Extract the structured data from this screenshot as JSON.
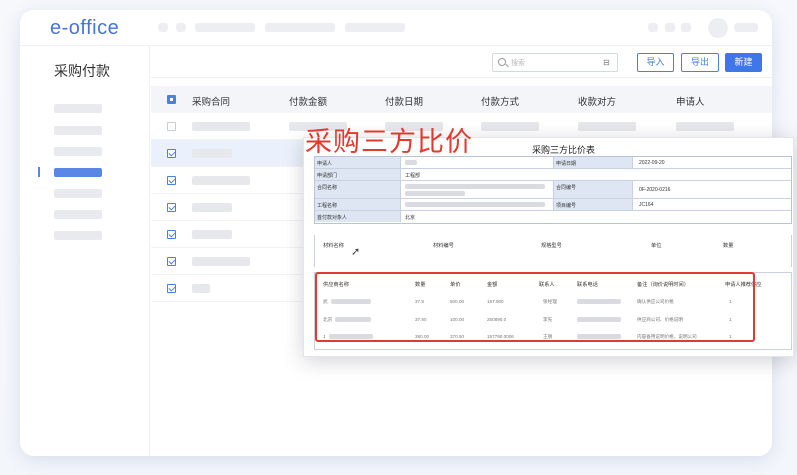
{
  "app": {
    "logo": "e-office"
  },
  "sidebar": {
    "title": "采购付款"
  },
  "toolbar": {
    "search_placeholder": "搜索",
    "filter_glyph": "⊟",
    "import_label": "导入",
    "export_label": "导出",
    "new_label": "新建"
  },
  "table": {
    "headers": [
      "采购合同",
      "付款金额",
      "付款日期",
      "付款方式",
      "收款对方",
      "申请人"
    ],
    "selected_rows": [
      1,
      2,
      3,
      4,
      5,
      6
    ]
  },
  "overlay": {
    "headline": "采购三方比价",
    "form_title": "采购三方比价表",
    "form": {
      "applicant_label": "申请人",
      "apply_date_label": "申请日期",
      "apply_date_value": "2022-09-20",
      "dept_label": "申请部门",
      "dept_value": "工程部",
      "contract_name_label": "合同名称",
      "contract_no_label": "合同编号",
      "contract_no_value": "0F-2020-0216",
      "project_label": "工程名称",
      "project_code_label": "项目编号",
      "project_code_value": "JC164",
      "payee_label": "首付款对象人",
      "payee_value": "北京"
    },
    "materials_headers": [
      "材料名称",
      "材料编号",
      "规格型号",
      "单位",
      "数量"
    ],
    "supplier_headers": [
      "供应商名称",
      "数量",
      "单价",
      "金额",
      "联系人",
      "联系电话",
      "备注（询价说明时间）",
      "申请人推荐供应"
    ],
    "suppliers": [
      {
        "name_prefix": "武",
        "qty": "37.8",
        "price": "500.00",
        "amount": "157.900",
        "contact": "张经理",
        "note": "确认供应公司价格",
        "rec": "1"
      },
      {
        "name_prefix": "北京",
        "qty": "37.80",
        "price": "100.00",
        "amount": "250890.0",
        "contact": "李先",
        "note": "供应商公司、价格说明",
        "rec": "1"
      },
      {
        "name_prefix": "J",
        "qty": "380.00",
        "price": "370.50",
        "amount": "157790.0006",
        "contact": "王朋",
        "note": "内容备用说明价格，说明公司",
        "rec": "1"
      }
    ]
  }
}
